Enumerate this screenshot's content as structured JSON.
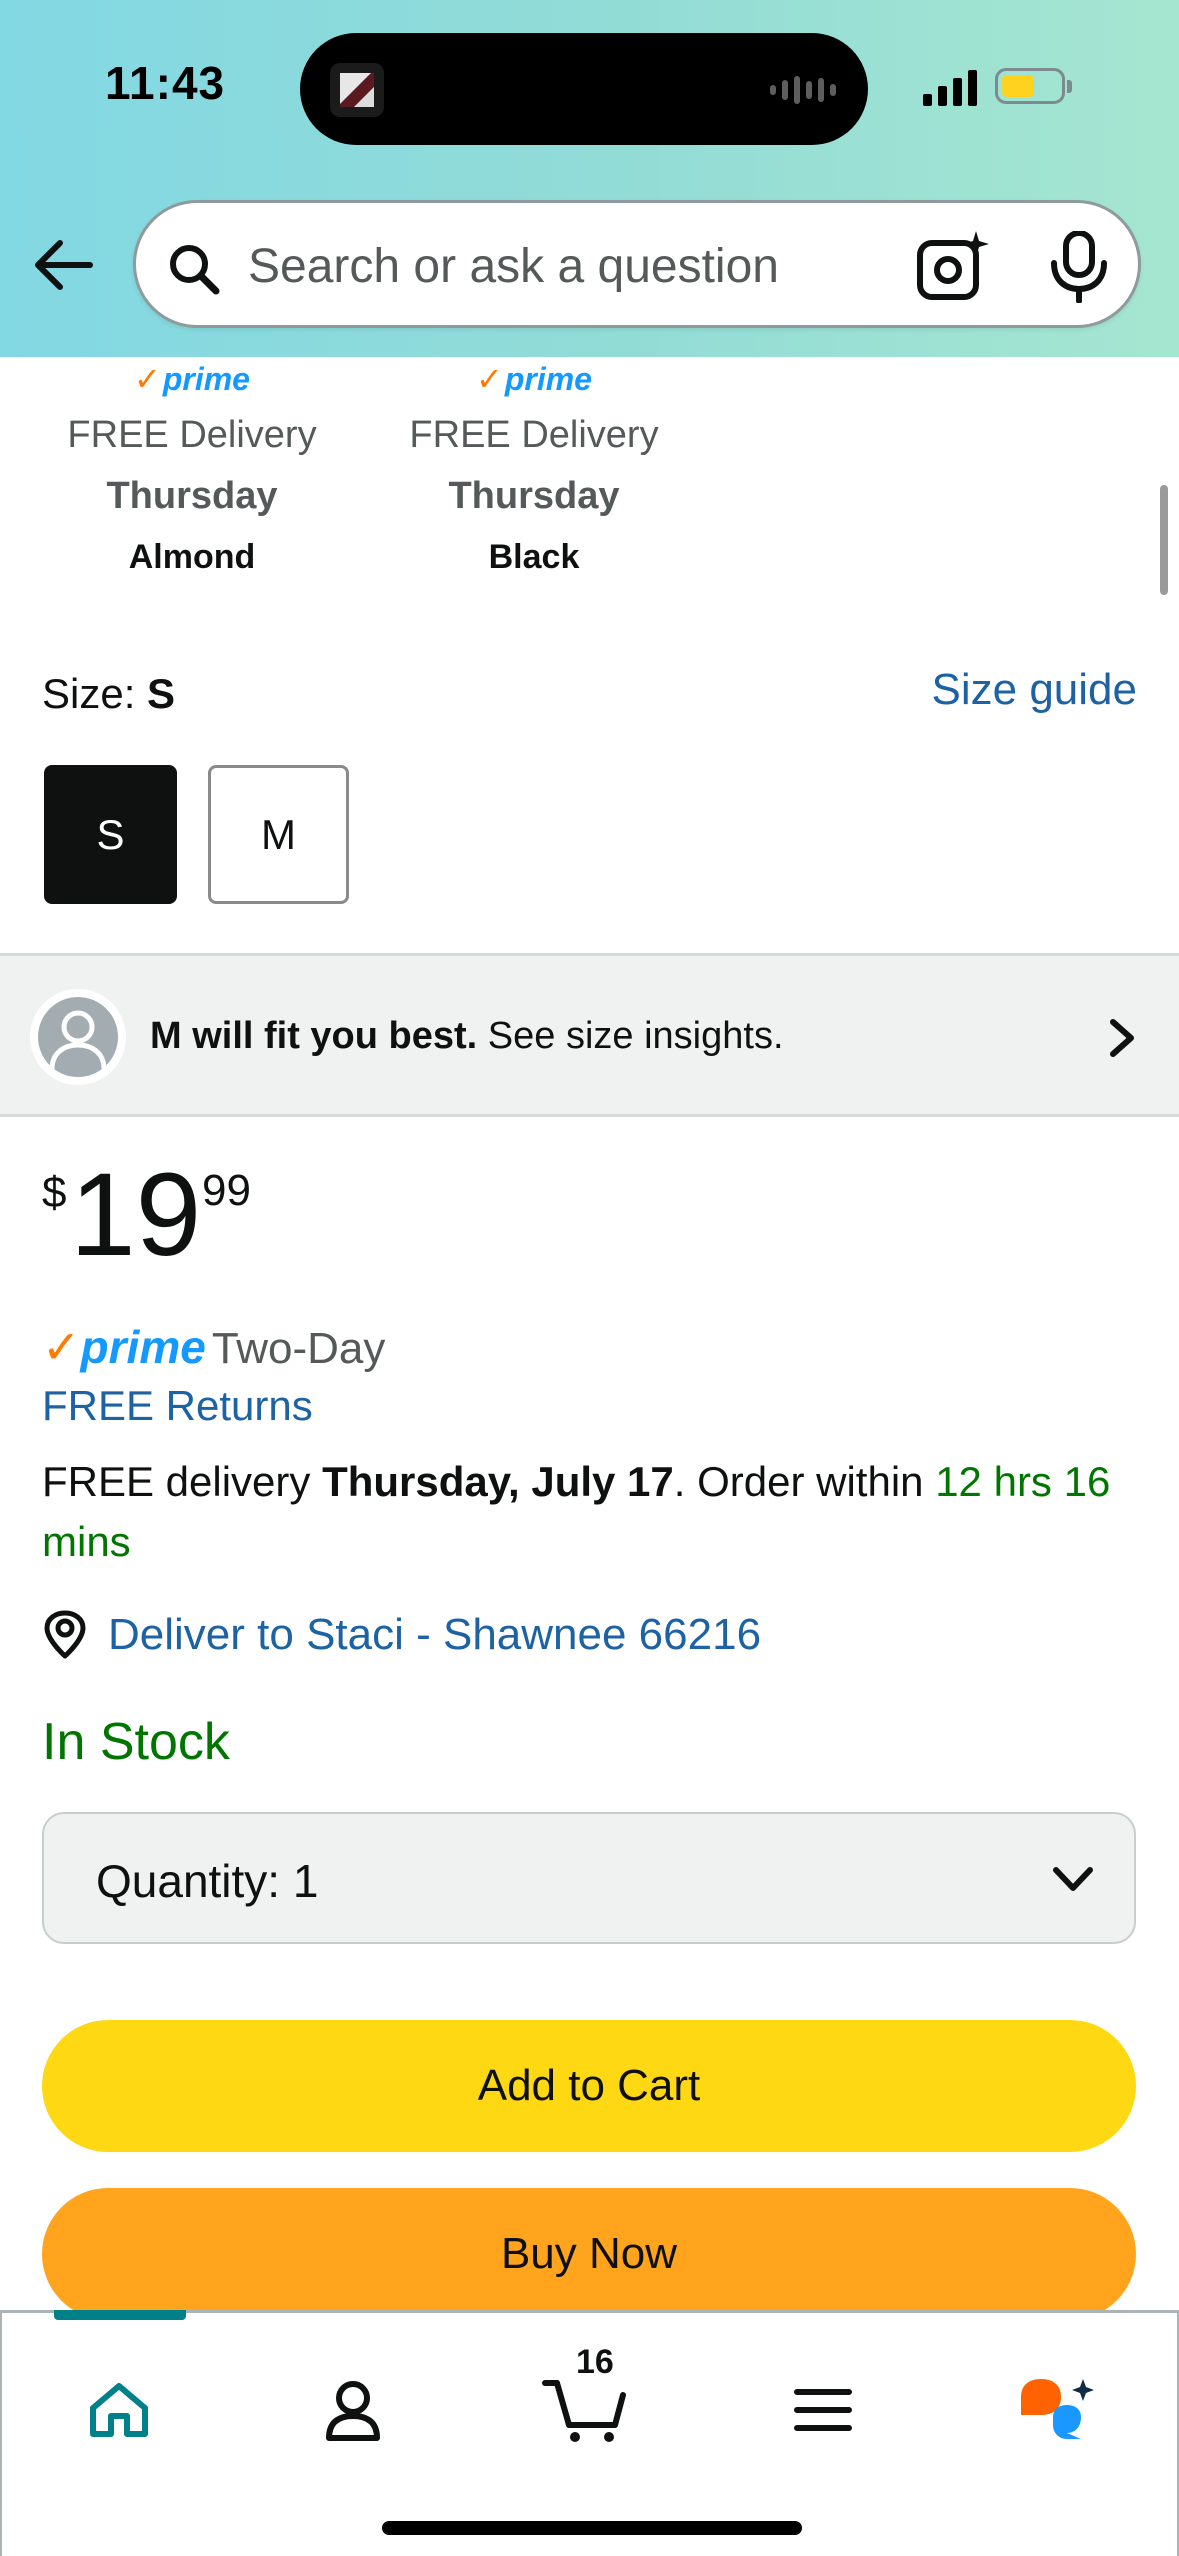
{
  "status_bar": {
    "time": "11:43"
  },
  "search": {
    "placeholder": "Search or ask a question"
  },
  "variants": [
    {
      "prime": "prime",
      "delivery": "FREE Delivery",
      "day": "Thursday",
      "color": "Almond"
    },
    {
      "prime": "prime",
      "delivery": "FREE Delivery",
      "day": "Thursday",
      "color": "Black"
    }
  ],
  "size": {
    "label": "Size:",
    "selected": "S",
    "guide_label": "Size guide",
    "options": [
      "S",
      "M"
    ]
  },
  "fit": {
    "bold_text": "M will fit you best.",
    "text": "See size insights."
  },
  "price": {
    "symbol": "$",
    "whole": "19",
    "fraction": "99"
  },
  "prime_row": {
    "logo": "prime",
    "label": "Two-Day"
  },
  "free_returns": "FREE Returns",
  "delivery": {
    "prefix": "FREE delivery",
    "date": "Thursday, July 17",
    "order_within": ". Order within",
    "countdown": "12 hrs 16 mins"
  },
  "deliver_to": "Deliver to Staci - Shawnee 66216",
  "stock_status": "In Stock",
  "quantity": {
    "label": "Quantity:",
    "value": "1"
  },
  "buttons": {
    "add_to_cart": "Add to Cart",
    "buy_now": "Buy Now"
  },
  "bottom_nav": {
    "items": [
      "home-icon",
      "account-icon",
      "cart-icon",
      "menu-icon",
      "rufus-icon"
    ],
    "cart_count": "16",
    "active": "home"
  },
  "colors": {
    "header_gradient": [
      "#82d8e3",
      "#a5e6d0"
    ],
    "link": "#1d62a3",
    "in_stock": "#007600",
    "add_to_cart": "#ffd814",
    "buy_now": "#ffa41c",
    "prime_blue": "#1399ff",
    "prime_check": "#ff7a00",
    "active_tab": "#00818a"
  }
}
